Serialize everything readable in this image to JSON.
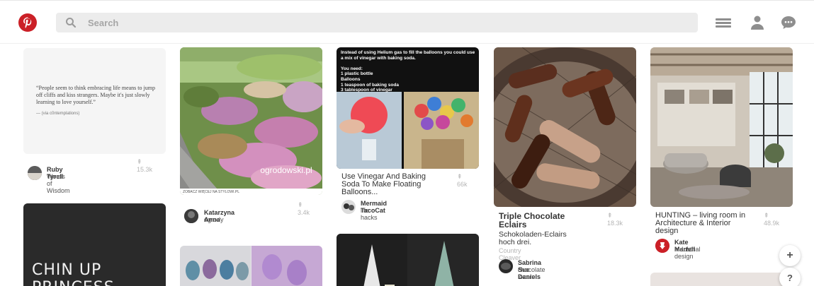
{
  "header": {
    "search_placeholder": "Search",
    "logo_icon": "pinterest-logo-icon",
    "menu_icon": "hamburger-menu-icon",
    "profile_icon": "person-icon",
    "messages_icon": "chat-bubble-icon"
  },
  "pins": [
    {
      "quote": "“People seem to think embracing life means to jump off cliffs and kiss strangers. Maybe it's just slowly learning to love yourself.”",
      "quote_attr": "— (via c0ntemplations)",
      "saves": "⇞ 15.3k",
      "author": "Ruby Tyrell",
      "board": "Words of Wisdom"
    },
    {
      "watermark": "ogrodowski.pl",
      "caption": "ZOBACZ WIĘCEJ NA  STYLOWI.PL",
      "saves": "⇞ 3.4k",
      "author": "Katarzyna Anna",
      "board": "ogrody"
    },
    {
      "overlay_text": "Instead of using Helium gas to fill the balloons you could use a mix of vinegar with baking soda.\n\nYou need:\n1 plastic bottle\nBalloons\n1 teaspoon of baking soda\n3 tablespoon of vinegar",
      "title": "Use Vinegar And Baking Soda To Make Floating Balloons...",
      "saves": "⇞ 66k",
      "author": "Mermaid TacoCat",
      "board": "life hacks"
    },
    {
      "title": "Triple Chocolate Eclairs",
      "description": "Schokoladen-Eclairs hoch drei.",
      "source": "Country Cleaver",
      "saves": "⇞ 18.3k",
      "author": "Sabrina Sue Daniels",
      "board": "chocolate lovers"
    },
    {
      "title": "HUNTING – living room in Architecture & Interior design",
      "saves": "⇞ 48.9k",
      "author": "Kate Marfell",
      "board": "Industrial design"
    },
    {
      "chalk_text": "CHIN UP PRINCESS"
    }
  ],
  "fab": {
    "add_label": "+",
    "help_label": "?"
  },
  "colors": {
    "brand": "#cb2027",
    "search_bg": "#ececec"
  }
}
